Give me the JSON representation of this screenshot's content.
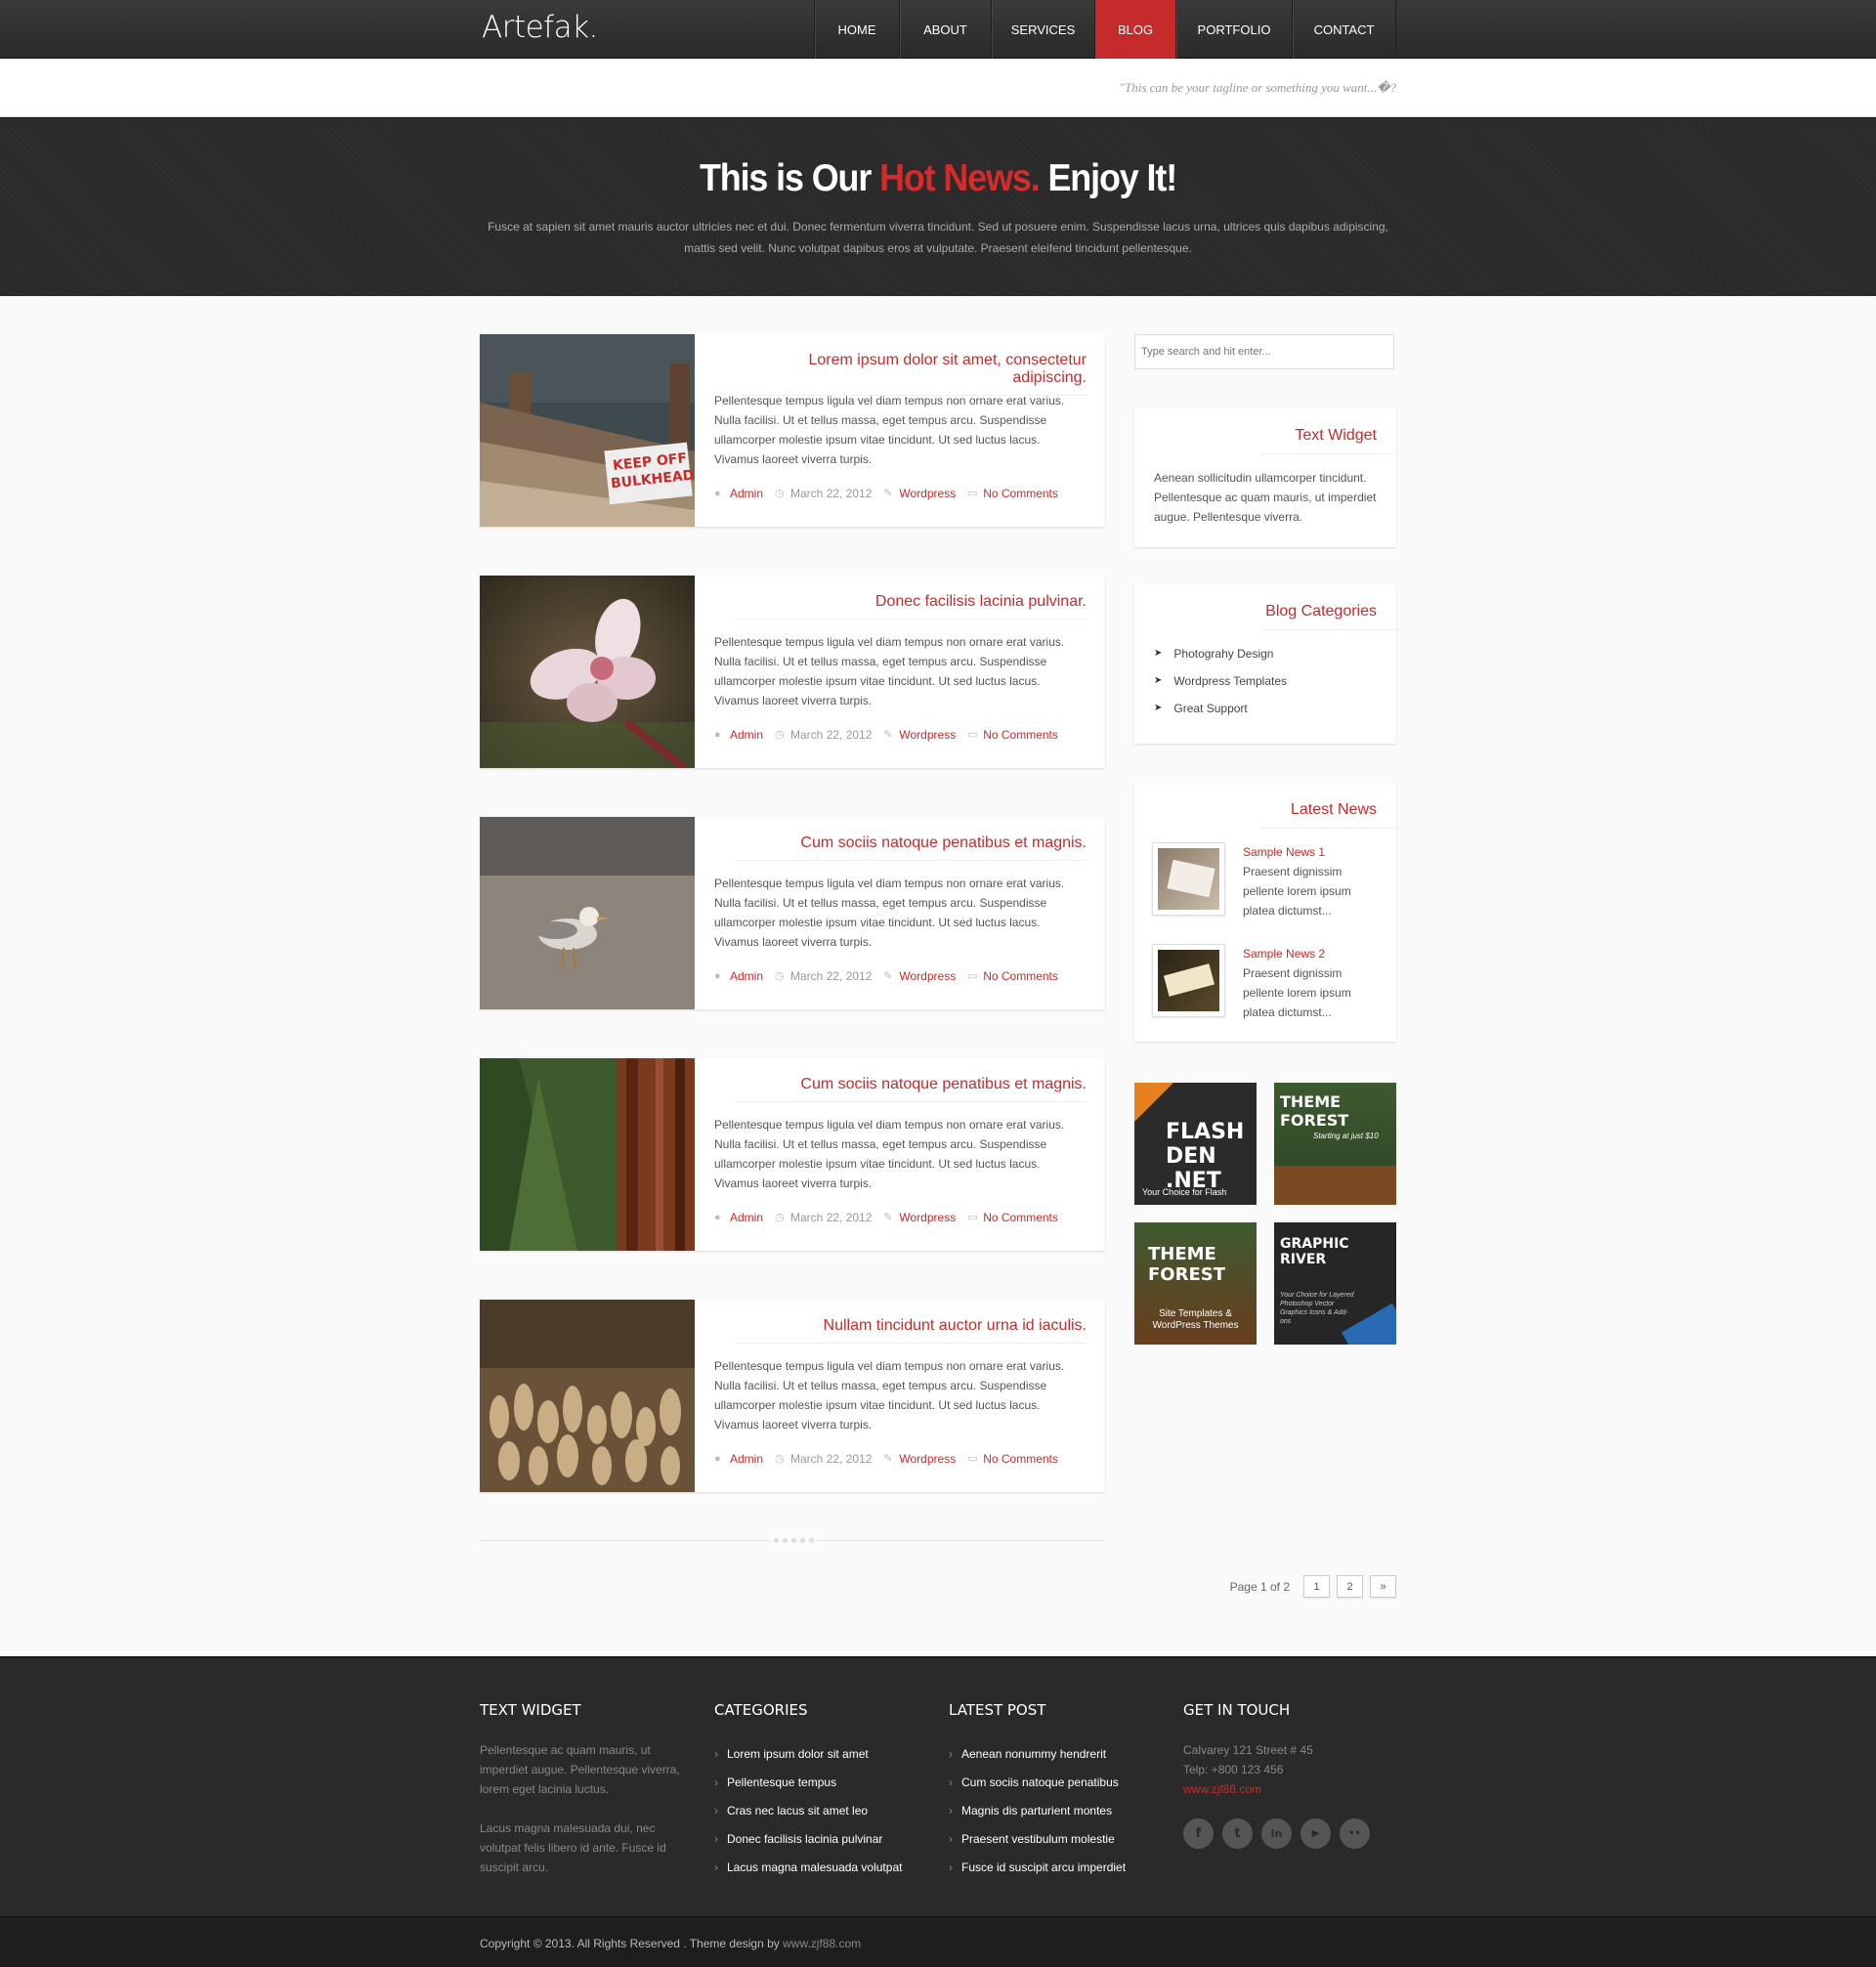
{
  "header": {
    "logo": "Artefak.",
    "nav": [
      {
        "label": "HOME"
      },
      {
        "label": "ABOUT"
      },
      {
        "label": "SERVICES"
      },
      {
        "label": "BLOG",
        "active": true
      },
      {
        "label": "PORTFOLIO"
      },
      {
        "label": "CONTACT"
      }
    ],
    "tagline": "\"This can be your tagline or something you want...�?"
  },
  "hero": {
    "title_start": "This is Our",
    "title_hot": "Hot News.",
    "title_end": "Enjoy It!",
    "text": "Fusce at sapien sit amet mauris auctor ultricies nec et dui. Donec fermentum viverra tincidunt. Sed ut posuere enim. Suspendisse lacus urna, ultrices quis dapibus adipiscing, mattis sed velit. Nunc volutpat dapibus eros at vulputate. Praesent eleifend tincidunt pellentesque."
  },
  "posts": [
    {
      "title": "Lorem ipsum dolor sit amet, consectetur adipiscing.",
      "body": "Pellentesque tempus ligula vel diam tempus non ornare erat varius. Nulla facilisi. Ut et tellus massa, eget tempus arcu. Suspendisse ullamcorper molestie ipsum vitae tincidunt. Ut sed luctus lacus. Vivamus laoreet viverra turpis.",
      "author": "Admin",
      "date": "March 22, 2012",
      "category": "Wordpress",
      "comments": "No Comments",
      "sign_line1": "KEEP OFF",
      "sign_line2": "BULKHEAD"
    },
    {
      "title": "Donec facilisis lacinia pulvinar.",
      "body": "Pellentesque tempus ligula vel diam tempus non ornare erat varius. Nulla facilisi. Ut et tellus massa, eget tempus arcu. Suspendisse ullamcorper molestie ipsum vitae tincidunt. Ut sed luctus lacus. Vivamus laoreet viverra turpis.",
      "author": "Admin",
      "date": "March 22, 2012",
      "category": "Wordpress",
      "comments": "No Comments"
    },
    {
      "title": "Cum sociis natoque penatibus et magnis.",
      "body": "Pellentesque tempus ligula vel diam tempus non ornare erat varius. Nulla facilisi. Ut et tellus massa, eget tempus arcu. Suspendisse ullamcorper molestie ipsum vitae tincidunt. Ut sed luctus lacus. Vivamus laoreet viverra turpis.",
      "author": "Admin",
      "date": "March 22, 2012",
      "category": "Wordpress",
      "comments": "No Comments"
    },
    {
      "title": "Cum sociis natoque penatibus et magnis.",
      "body": "Pellentesque tempus ligula vel diam tempus non ornare erat varius. Nulla facilisi. Ut et tellus massa, eget tempus arcu. Suspendisse ullamcorper molestie ipsum vitae tincidunt. Ut sed luctus lacus. Vivamus laoreet viverra turpis.",
      "author": "Admin",
      "date": "March 22, 2012",
      "category": "Wordpress",
      "comments": "No Comments"
    },
    {
      "title": "Nullam tincidunt auctor urna id iaculis.",
      "body": "Pellentesque tempus ligula vel diam tempus non ornare erat varius. Nulla facilisi. Ut et tellus massa, eget tempus arcu. Suspendisse ullamcorper molestie ipsum vitae tincidunt. Ut sed luctus lacus. Vivamus laoreet viverra turpis.",
      "author": "Admin",
      "date": "March 22, 2012",
      "category": "Wordpress",
      "comments": "No Comments"
    }
  ],
  "pagination": {
    "label": "Page 1 of 2",
    "pages": [
      "1",
      "2"
    ],
    "next": "»"
  },
  "sidebar": {
    "search_placeholder": "Type search and hit enter...",
    "text_widget": {
      "title": "Text Widget",
      "text": "Aenean sollicitudin ullamcorper tincidunt. Pellentesque ac quam mauris, ut imperdiet augue. Pellentesque viverra."
    },
    "categories": {
      "title": "Blog Categories",
      "items": [
        "Photograhy Design",
        "Wordpress Templates",
        "Great Support"
      ]
    },
    "latest_news": {
      "title": "Latest News",
      "items": [
        {
          "title": "Sample News 1",
          "desc": "Praesent dignissim pellente lorem ipsum platea dictumst..."
        },
        {
          "title": "Sample News 2",
          "desc": "Praesent dignissim pellente lorem ipsum platea dictumst..."
        }
      ]
    },
    "ads": [
      {
        "name": "FLASH DEN .NET",
        "caption": "Your Choice for Flash"
      },
      {
        "name": "THEME FOREST",
        "caption": "Starting at just $10"
      },
      {
        "name": "THEME FOREST",
        "caption": "Site Templates & WordPress Themes"
      },
      {
        "name": "GRAPHIC RIVER",
        "caption": "Your Choice for Layered Photoshop Vector Graphics Icons & Add-ons"
      }
    ]
  },
  "footer": {
    "text_widget": {
      "title": "TEXT WIDGET",
      "p1": "Pellentesque ac quam mauris, ut imperdiet augue. Pellentesque viverra, lorem eget lacinia luctus.",
      "p2": "Lacus magna malesuada dui, nec volutpat felis libero id ante. Fusce id suscipit arcu."
    },
    "categories": {
      "title": "CATEGORIES",
      "items": [
        "Lorem ipsum dolor sit amet",
        "Pellentesque tempus",
        "Cras nec lacus sit amet leo",
        "Donec facilisis lacinia pulvinar",
        "Lacus magna malesuada volutpat"
      ]
    },
    "latest_post": {
      "title": "LATEST POST",
      "items": [
        "Aenean nonummy hendrerit",
        "Cum sociis natoque penatibus",
        "Magnis dis parturient montes",
        "Praesent vestibulum molestie",
        "Fusce id suscipit arcu imperdiet"
      ]
    },
    "contact": {
      "title": "GET IN TOUCH",
      "address": "Calvarey 121 Street # 45",
      "phone": "Telp: +800 123 456",
      "website": "www.zjf88.com"
    },
    "socials": [
      {
        "icon": "facebook-icon",
        "glyph": "f"
      },
      {
        "icon": "twitter-icon",
        "glyph": "t"
      },
      {
        "icon": "linkedin-icon",
        "glyph": "in"
      },
      {
        "icon": "youtube-icon",
        "glyph": "▶"
      },
      {
        "icon": "flickr-icon",
        "glyph": "••"
      }
    ],
    "copyright": "Copyright © 2013. All Rights Reserved . Theme design by",
    "credit": "www.zjf88.com"
  },
  "colors": {
    "accent": "#c62b2b",
    "dark": "#2a2a2a"
  }
}
